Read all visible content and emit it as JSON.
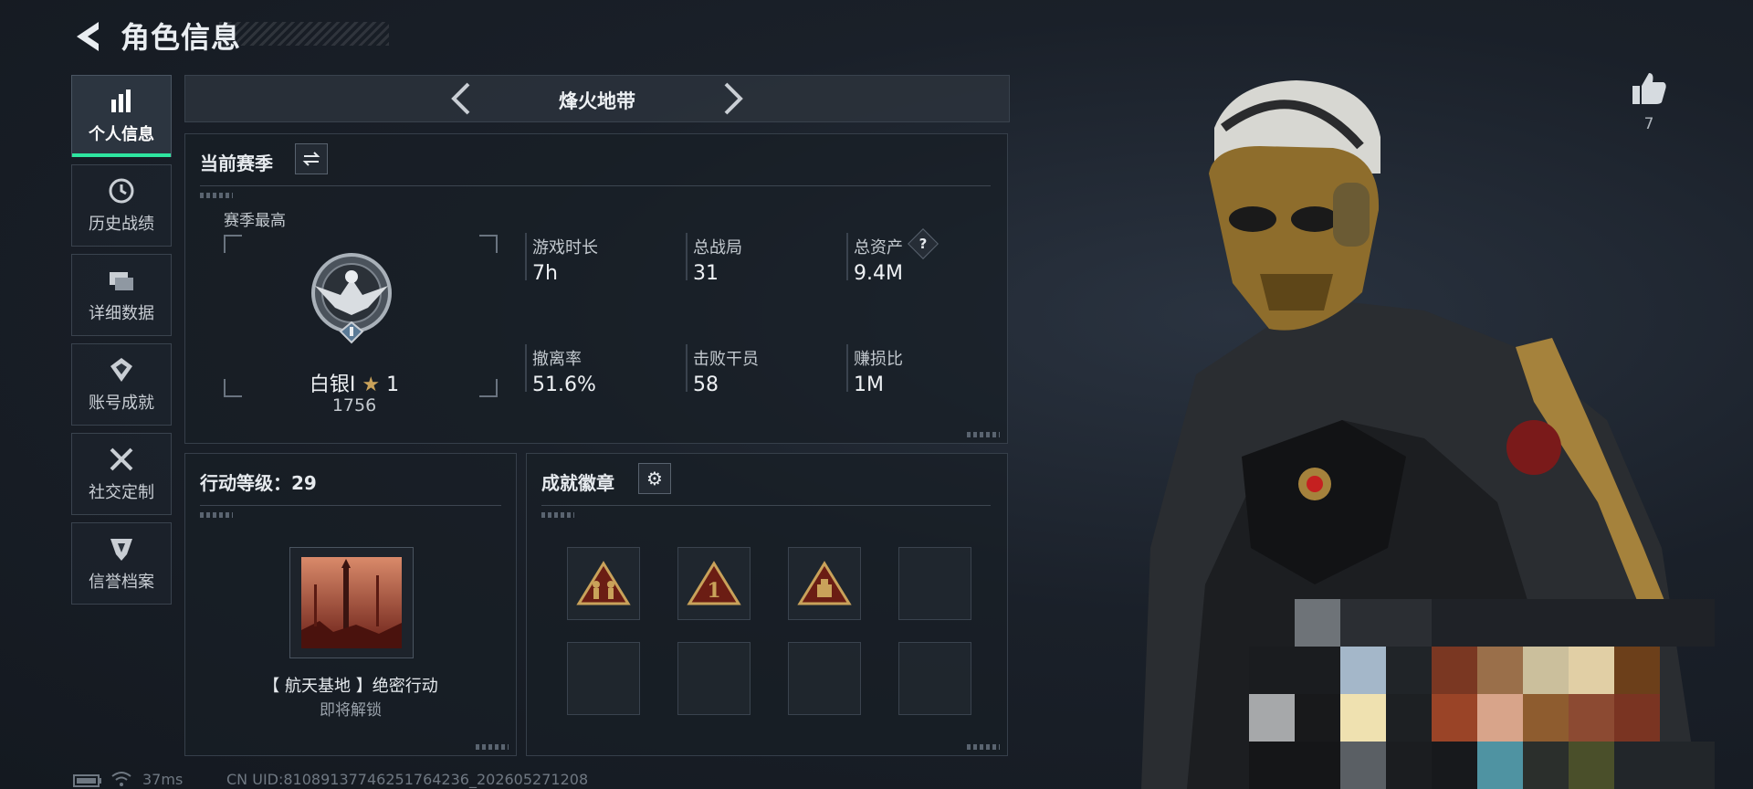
{
  "header": {
    "title": "角色信息"
  },
  "nav": [
    {
      "label": "个人信息",
      "icon": "bar-chart-icon",
      "active": true
    },
    {
      "label": "历史战绩",
      "icon": "history-icon"
    },
    {
      "label": "详细数据",
      "icon": "folders-icon"
    },
    {
      "label": "账号成就",
      "icon": "achievement-icon"
    },
    {
      "label": "社交定制",
      "icon": "tools-icon"
    },
    {
      "label": "信誉档案",
      "icon": "shield-icon"
    }
  ],
  "mode": {
    "title": "烽火地带"
  },
  "season": {
    "title": "当前赛季",
    "best_label": "赛季最高",
    "rank_name": "白银I",
    "rank_stars": "1",
    "rank_score": "1756",
    "stats": [
      {
        "label": "游戏时长",
        "value": "7h"
      },
      {
        "label": "总战局",
        "value": "31"
      },
      {
        "label": "总资产",
        "value": "9.4M",
        "help": "?"
      },
      {
        "label": "撤离率",
        "value": "51.6%"
      },
      {
        "label": "击败干员",
        "value": "58"
      },
      {
        "label": "赚损比",
        "value": "1M"
      }
    ]
  },
  "action_level": {
    "title": "行动等级：29",
    "mission_name": "【 航天基地 】绝密行动",
    "mission_status": "即将解锁"
  },
  "achievements": {
    "title": "成就徽章"
  },
  "likes": {
    "count": "7"
  },
  "footer": {
    "ping": "37ms",
    "uid": "CN UID:810891377462517642​36_202605271208"
  },
  "colors": {
    "accent": "#2ee6a0",
    "gold": "#c9a25a"
  }
}
